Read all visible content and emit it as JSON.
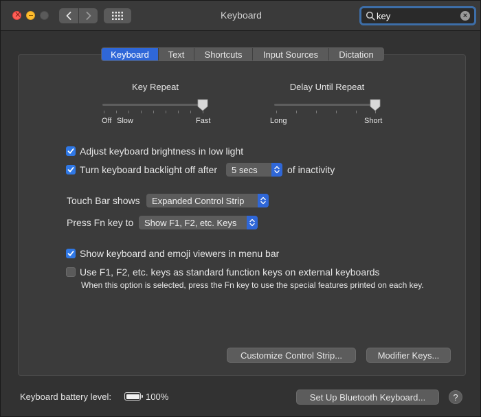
{
  "window": {
    "title": "Keyboard"
  },
  "search": {
    "value": "key"
  },
  "tabs": [
    {
      "label": "Keyboard",
      "active": true
    },
    {
      "label": "Text"
    },
    {
      "label": "Shortcuts"
    },
    {
      "label": "Input Sources"
    },
    {
      "label": "Dictation"
    }
  ],
  "key_repeat": {
    "title": "Key Repeat",
    "label_off": "Off",
    "label_slow": "Slow",
    "label_fast": "Fast",
    "level_percent": 100
  },
  "delay_until_repeat": {
    "title": "Delay Until Repeat",
    "label_long": "Long",
    "label_short": "Short",
    "level_percent": 100
  },
  "options": {
    "adjust_brightness": {
      "label": "Adjust keyboard brightness in low light",
      "checked": true
    },
    "backlight_off": {
      "label": "Turn keyboard backlight off after",
      "checked": true,
      "value": "5 secs",
      "suffix": "of inactivity"
    },
    "show_viewers": {
      "label": "Show keyboard and emoji viewers in menu bar",
      "checked": true
    },
    "use_f_keys": {
      "label": "Use F1, F2, etc. keys as standard function keys on external keyboards",
      "checked": false,
      "note": "When this option is selected, press the Fn key to use the special features printed on each key."
    }
  },
  "touch_bar": {
    "label": "Touch Bar shows",
    "value": "Expanded Control Strip"
  },
  "fn_key": {
    "label": "Press Fn key to",
    "value": "Show F1, F2, etc. Keys"
  },
  "buttons": {
    "customize": "Customize Control Strip...",
    "modifier": "Modifier Keys...",
    "bluetooth": "Set Up Bluetooth Keyboard...",
    "help": "?"
  },
  "battery": {
    "label": "Keyboard battery level:",
    "percent": "100%"
  },
  "colors": {
    "accent": "#2f67d8",
    "checkbox": "#2f78e6",
    "close": "#ff5f57",
    "minimize": "#febc2e"
  }
}
